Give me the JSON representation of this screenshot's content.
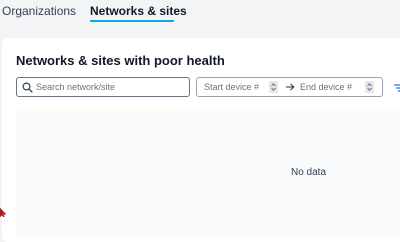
{
  "tabs": [
    {
      "label": "Organizations",
      "active": false
    },
    {
      "label": "Networks & sites",
      "active": true
    }
  ],
  "card": {
    "title": "Networks & sites with poor health",
    "search": {
      "placeholder": "Search network/site",
      "value": ""
    },
    "device_range": {
      "start_placeholder": "Start device #",
      "end_placeholder": "End device #",
      "separator_icon": "arrow-right-icon"
    },
    "filter_icon": "filter-icon",
    "empty_state": "No data"
  },
  "colors": {
    "accent": "#0ea5e9",
    "page_background": "#f3f4f6",
    "card_background": "#ffffff",
    "empty_panel": "#f9fafb",
    "cursor": "#b91c1c"
  }
}
